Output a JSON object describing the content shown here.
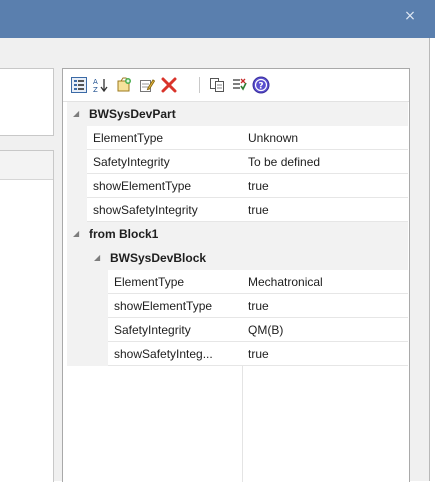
{
  "window": {
    "close_glyph": "×"
  },
  "toolbar": {
    "buttons": [
      {
        "name": "categorized-view-icon"
      },
      {
        "name": "sort-alphabetical-icon"
      },
      {
        "name": "new-property-icon"
      },
      {
        "name": "edit-property-icon"
      },
      {
        "name": "delete-property-icon"
      },
      {
        "name": "copy-properties-icon"
      },
      {
        "name": "filter-properties-icon"
      },
      {
        "name": "help-icon"
      }
    ]
  },
  "properties": {
    "group1": {
      "label": "BWSysDevPart",
      "rows": [
        {
          "name": "ElementType",
          "value": "Unknown"
        },
        {
          "name": "SafetyIntegrity",
          "value": "To be defined"
        },
        {
          "name": "showElementType",
          "value": "true"
        },
        {
          "name": "showSafetyIntegrity",
          "value": "true"
        }
      ]
    },
    "group2": {
      "label": "from Block1",
      "sub": {
        "label": "BWSysDevBlock",
        "rows": [
          {
            "name": "ElementType",
            "value": "Mechatronical"
          },
          {
            "name": "showElementType",
            "value": "true"
          },
          {
            "name": "SafetyIntegrity",
            "value": "QM(B)"
          },
          {
            "name": "showSafetyInteg...",
            "value": "true"
          }
        ]
      }
    }
  }
}
